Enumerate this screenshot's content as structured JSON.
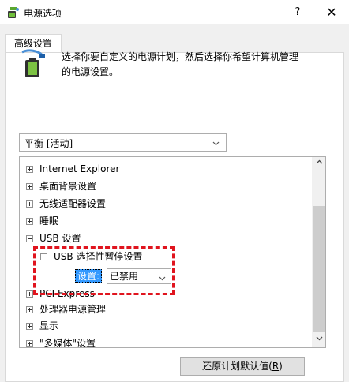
{
  "window": {
    "title": "电源选项",
    "help_label": "?",
    "close_label": "✕"
  },
  "tabs": [
    {
      "label": "高级设置",
      "active": true
    }
  ],
  "description": {
    "line1": "选择你要自定义的电源计划，然后选择你希望计算机管理",
    "line2": "的电源设置。"
  },
  "plan_select": {
    "value": "平衡 [活动]"
  },
  "tree": {
    "items": [
      {
        "label": "Internet Explorer",
        "expander": "plus"
      },
      {
        "label": "桌面背景设置",
        "expander": "plus"
      },
      {
        "label": "无线适配器设置",
        "expander": "plus"
      },
      {
        "label": "睡眠",
        "expander": "plus"
      },
      {
        "label": "USB 设置",
        "expander": "minus"
      },
      {
        "label": "USB 选择性暂停设置",
        "expander": "minus"
      },
      {
        "label": "PCI Express",
        "expander": "plus"
      },
      {
        "label": "处理器电源管理",
        "expander": "plus"
      },
      {
        "label": "显示",
        "expander": "plus"
      },
      {
        "label": "\"多媒体\"设置",
        "expander": "plus"
      }
    ],
    "setting": {
      "label": "设置:",
      "value": "已禁用"
    }
  },
  "buttons": {
    "restore_label": "还原计划默认值(",
    "restore_accel": "R",
    "restore_suffix": ")"
  },
  "colors": {
    "selection": "#3399ff",
    "highlight_border": "#e0141e"
  }
}
